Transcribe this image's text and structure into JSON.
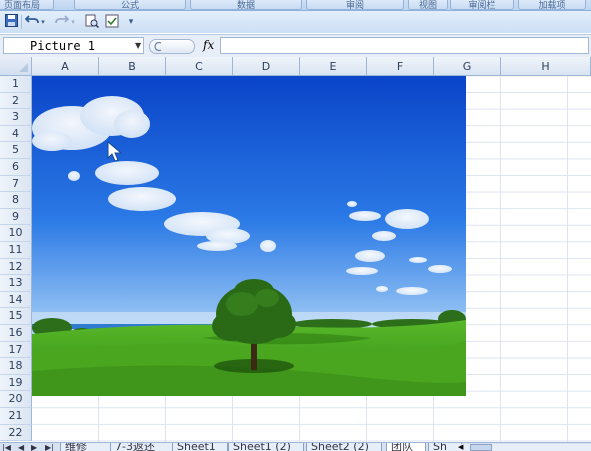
{
  "ribbon_tabs": [
    "页面布局",
    "公式",
    "数据",
    "审阅",
    "视图",
    "",
    "审阅栏",
    "加载项"
  ],
  "quick_access": {
    "icons": [
      "save-icon",
      "undo-icon",
      "undo-dropdown-icon",
      "redo-icon",
      "redo-dropdown-icon",
      "print-preview-icon",
      "spelling-icon",
      "customize-toolbar-icon"
    ]
  },
  "formula_bar": {
    "name_box": "Picture 1",
    "fx_label": "fx",
    "formula": ""
  },
  "grid": {
    "columns": [
      "A",
      "B",
      "C",
      "D",
      "E",
      "F",
      "G",
      "H"
    ],
    "rows": [
      "1",
      "2",
      "3",
      "4",
      "5",
      "6",
      "7",
      "8",
      "9",
      "10",
      "11",
      "12",
      "13",
      "14",
      "15",
      "16",
      "17",
      "18",
      "19",
      "20",
      "21",
      "22"
    ]
  },
  "picture": {
    "name": "Picture 1",
    "description_colors": {
      "sky": "#1a5fd8",
      "grass": "#3f9a1f",
      "tree": "#1f5e14"
    }
  },
  "sheet_tabs": {
    "nav": [
      "⏮",
      "◀",
      "▶",
      "⏭"
    ],
    "tabs": [
      "维修",
      "7-3返还",
      "Sheet1",
      "Sheet1 (2)",
      "Sheet2 (2)",
      "团队",
      "Sh"
    ],
    "active_index": 5
  },
  "colors": {
    "header_bg": "#dbe5f2",
    "grid_line": "#dde4ee",
    "accent": "#2f5b9a"
  }
}
